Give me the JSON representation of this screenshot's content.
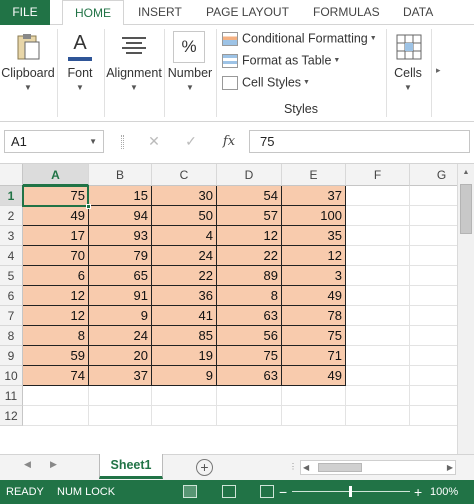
{
  "ribbon": {
    "tabs": [
      {
        "label": "FILE"
      },
      {
        "label": "HOME"
      },
      {
        "label": "INSERT"
      },
      {
        "label": "PAGE LAYOUT"
      },
      {
        "label": "FORMULAS"
      },
      {
        "label": "DATA"
      }
    ],
    "groups": {
      "clipboard": {
        "label": "Clipboard",
        "icon": "clipboard-icon"
      },
      "font": {
        "label": "Font",
        "icon": "font-color-icon",
        "glyph": "A"
      },
      "alignment": {
        "label": "Alignment",
        "icon": "align-lines-icon"
      },
      "number": {
        "label": "Number",
        "icon": "percent-icon",
        "glyph": "%"
      },
      "styles": {
        "label": "Styles",
        "conditional_formatting": "Conditional Formatting",
        "format_as_table": "Format as Table",
        "cell_styles": "Cell Styles"
      },
      "cells": {
        "label": "Cells",
        "icon": "cells-grid-icon"
      }
    },
    "scroll_right_glyph": "▸"
  },
  "formula_bar": {
    "name_box": "A1",
    "cancel_glyph": "✕",
    "enter_glyph": "✓",
    "fx_label": "fx",
    "value": "75"
  },
  "grid": {
    "columns": [
      "A",
      "B",
      "C",
      "D",
      "E",
      "F",
      "G"
    ],
    "rows": [
      "1",
      "2",
      "3",
      "4",
      "5",
      "6",
      "7",
      "8",
      "9",
      "10",
      "11",
      "12"
    ],
    "selected_cell": "A1",
    "fill_color": "#f8cbad",
    "values": [
      [
        75,
        15,
        30,
        54,
        37
      ],
      [
        49,
        94,
        50,
        57,
        100
      ],
      [
        17,
        93,
        4,
        12,
        35
      ],
      [
        70,
        79,
        24,
        22,
        12
      ],
      [
        6,
        65,
        22,
        89,
        3
      ],
      [
        12,
        91,
        36,
        8,
        49
      ],
      [
        12,
        9,
        41,
        63,
        78
      ],
      [
        8,
        24,
        85,
        56,
        75
      ],
      [
        59,
        20,
        19,
        75,
        71
      ],
      [
        74,
        37,
        9,
        63,
        49
      ]
    ]
  },
  "sheets": {
    "tabs": [
      "Sheet1"
    ],
    "active": "Sheet1",
    "add_glyph": "+",
    "nav_prev": "◀",
    "nav_next": "▶"
  },
  "status_bar": {
    "mode": "READY",
    "num_lock": "NUM LOCK",
    "zoom_minus": "−",
    "zoom_plus": "+",
    "zoom": "100%"
  },
  "colors": {
    "accent": "#217346",
    "cell_fill": "#f8cbad",
    "cell_border": "#222222"
  }
}
